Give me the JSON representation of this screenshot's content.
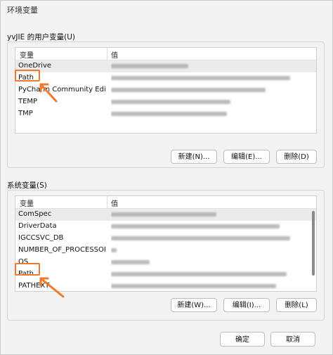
{
  "window": {
    "title": "环境变量"
  },
  "user_section": {
    "label": "yvJIE 的用户变量(U)",
    "col_name": "变量",
    "col_value": "值",
    "rows": [
      {
        "name": "OneDrive"
      },
      {
        "name": "Path"
      },
      {
        "name": "PyCharm Community Editi..."
      },
      {
        "name": "TEMP"
      },
      {
        "name": "TMP"
      }
    ],
    "buttons": {
      "new": "新建(N)...",
      "edit": "编辑(E)...",
      "delete": "删除(D)"
    }
  },
  "system_section": {
    "label": "系统变量(S)",
    "col_name": "变量",
    "col_value": "值",
    "rows": [
      {
        "name": "ComSpec"
      },
      {
        "name": "DriverData"
      },
      {
        "name": "IGCCSVC_DB"
      },
      {
        "name": "NUMBER_OF_PROCESSORS"
      },
      {
        "name": "OS"
      },
      {
        "name": "Path"
      },
      {
        "name": "PATHEXT"
      }
    ],
    "buttons": {
      "new": "新建(W)...",
      "edit": "编辑(I)...",
      "delete": "删除(L)"
    }
  },
  "footer": {
    "ok": "确定",
    "cancel": "取消"
  },
  "colors": {
    "annotation": "#f07a2a",
    "selected_row": "#ebebeb",
    "background": "#f3f3f3"
  }
}
